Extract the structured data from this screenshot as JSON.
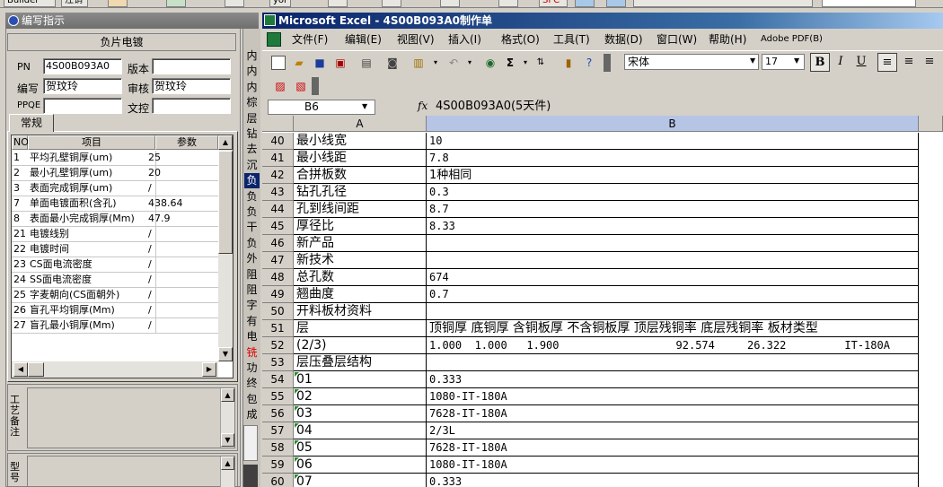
{
  "top_strip": {
    "builder_label": "Builder",
    "item2": "注销",
    "item3": "yor",
    "item4": "SFC"
  },
  "left_panel": {
    "title": "编写指示",
    "header": "负片电镀",
    "fields": [
      {
        "label": "PN",
        "value": "4S00B093A0"
      },
      {
        "label": "版本",
        "value": ""
      },
      {
        "label": "编写",
        "value": "贺玟玲"
      },
      {
        "label": "审核",
        "value": "贺玟玲"
      },
      {
        "label": "PPQE",
        "value": ""
      },
      {
        "label": "文控",
        "value": ""
      }
    ],
    "tab": "常规",
    "grid": {
      "headers": [
        "NO",
        "项目",
        "参数"
      ],
      "rows": [
        {
          "no": "1",
          "item": "平均孔壁铜厚(um)",
          "param": "25"
        },
        {
          "no": "2",
          "item": "最小孔壁铜厚(um)",
          "param": "20"
        },
        {
          "no": "3",
          "item": "表面完成铜厚(um)",
          "param": "/"
        },
        {
          "no": "7",
          "item": "单面电镀面积(含孔)",
          "param": "438.64"
        },
        {
          "no": "8",
          "item": "表面最小完成铜厚(Mm)",
          "param": "47.9"
        },
        {
          "no": "21",
          "item": "电镀线别",
          "param": "/"
        },
        {
          "no": "22",
          "item": "电镀时间",
          "param": "/"
        },
        {
          "no": "23",
          "item": "CS面电流密度",
          "param": "/"
        },
        {
          "no": "24",
          "item": "SS面电流密度",
          "param": "/"
        },
        {
          "no": "25",
          "item": "字麦朝向(CS面朝外)",
          "param": "/"
        },
        {
          "no": "26",
          "item": "盲孔平均铜厚(Mm)",
          "param": "/"
        },
        {
          "no": "27",
          "item": "盲孔最小铜厚(Mm)",
          "param": "/"
        }
      ]
    },
    "memo1_label": "工艺备注",
    "memo2_label": "型号"
  },
  "vertical_strip": [
    "内",
    "内",
    "内",
    "棕",
    "层",
    "钻",
    "去",
    "沉",
    "负",
    "负",
    "负",
    "干",
    "负",
    "外",
    "阻",
    "阻",
    "字",
    "有",
    "电",
    "铣",
    "功",
    "终",
    "包",
    "成"
  ],
  "excel": {
    "title": "Microsoft Excel - 4S00B093A0制作单",
    "menu": [
      "文件(F)",
      "编辑(E)",
      "视图(V)",
      "插入(I)",
      "格式(O)",
      "工具(T)",
      "数据(D)",
      "窗口(W)",
      "帮助(H)",
      "Adobe PDF(B)"
    ],
    "font_name": "宋体",
    "font_size": "17",
    "name_box": "B6",
    "fx_label": "fx",
    "formula": "4S00B093A0(5天件)",
    "columns": [
      "A",
      "B"
    ],
    "rows": [
      {
        "num": "40",
        "a": "最小线宽",
        "b": "10"
      },
      {
        "num": "41",
        "a": "最小线距",
        "b": "7.8"
      },
      {
        "num": "42",
        "a": "合拼板数",
        "b": "1种相同"
      },
      {
        "num": "43",
        "a": "钻孔孔径",
        "b": "0.3"
      },
      {
        "num": "44",
        "a": "孔到线间距",
        "b": "8.7"
      },
      {
        "num": "45",
        "a": "厚径比",
        "b": "8.33"
      },
      {
        "num": "46",
        "a": "新产品",
        "b": ""
      },
      {
        "num": "47",
        "a": "新技术",
        "b": ""
      },
      {
        "num": "48",
        "a": "总孔数",
        "b": "674"
      },
      {
        "num": "49",
        "a": "翘曲度",
        "b": "0.7"
      },
      {
        "num": "50",
        "a": "开料板材资料",
        "b": ""
      },
      {
        "num": "51",
        "a": "层",
        "b": "顶铜厚 底铜厚 含铜板厚 不含铜板厚 顶层残铜率 底层残铜率 板材类型"
      },
      {
        "num": "52",
        "a": "(2/3)",
        "b": "1.000  1.000   1.900                  92.574     26.322         IT-180A"
      },
      {
        "num": "53",
        "a": "层压叠层结构",
        "b": ""
      },
      {
        "num": "54",
        "a": "01",
        "b": "0.333"
      },
      {
        "num": "55",
        "a": "02",
        "b": "1080-IT-180A"
      },
      {
        "num": "56",
        "a": "03",
        "b": "7628-IT-180A"
      },
      {
        "num": "57",
        "a": "04",
        "b": "2/3L"
      },
      {
        "num": "58",
        "a": "05",
        "b": "7628-IT-180A"
      },
      {
        "num": "59",
        "a": "06",
        "b": "1080-IT-180A"
      },
      {
        "num": "60",
        "a": "07",
        "b": "0.333"
      }
    ]
  }
}
